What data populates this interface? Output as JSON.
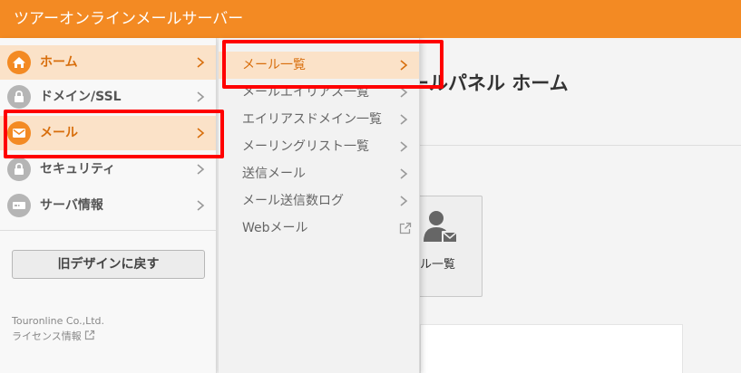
{
  "header": {
    "title": "ツアーオンラインメールサーバー"
  },
  "main": {
    "title": "ールパネル ホーム",
    "tile_label": "ール一覧"
  },
  "sidebar": {
    "items": [
      {
        "label": "ホーム",
        "icon": "home-icon",
        "active": true
      },
      {
        "label": "ドメイン/SSL",
        "icon": "domain-lock-icon",
        "active": false
      },
      {
        "label": "メール",
        "icon": "mail-icon",
        "active": true
      },
      {
        "label": "セキュリティ",
        "icon": "lock-icon",
        "active": false
      },
      {
        "label": "サーバ情報",
        "icon": "server-icon",
        "active": false
      }
    ],
    "old_design_button": "旧デザインに戻す",
    "company": "Touronline Co.,Ltd.",
    "license_link": "ライセンス情報"
  },
  "submenu": {
    "items": [
      {
        "label": "メール一覧",
        "active": true
      },
      {
        "label": "メールエイリアス一覧",
        "active": false
      },
      {
        "label": "エイリアスドメイン一覧",
        "active": false
      },
      {
        "label": "メーリングリスト一覧",
        "active": false
      },
      {
        "label": "送信メール",
        "active": false
      },
      {
        "label": "メール送信数ログ",
        "active": false
      },
      {
        "label": "Webメール",
        "active": false,
        "external": true
      }
    ]
  },
  "colors": {
    "accent": "#f38a23",
    "active_bg": "#fbe2c8",
    "highlight": "#ff0000"
  }
}
